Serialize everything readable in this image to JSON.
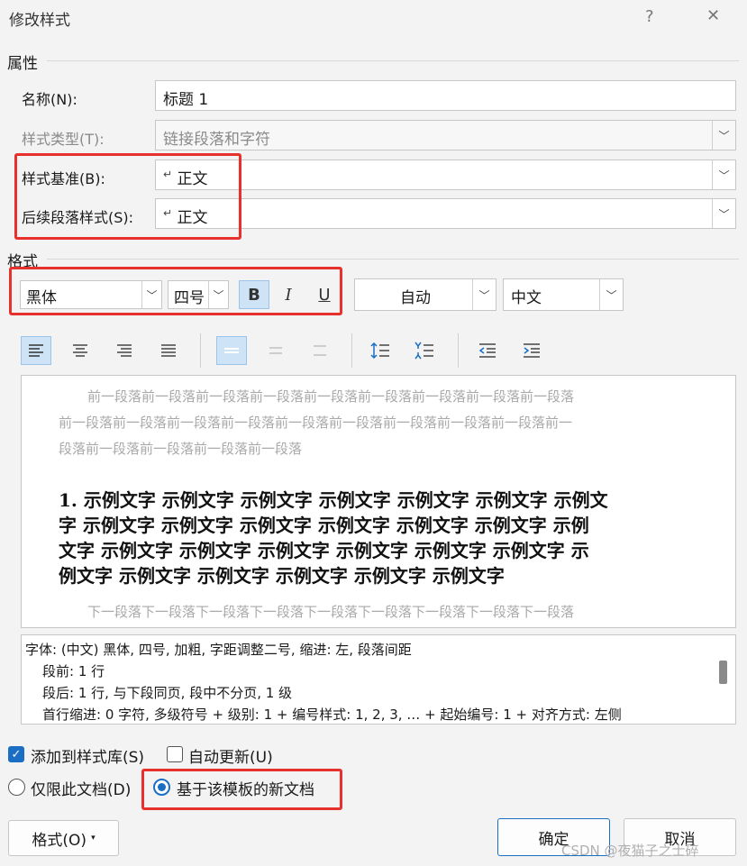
{
  "window": {
    "title": "修改样式",
    "help_glyph": "?",
    "close_glyph": "✕"
  },
  "properties": {
    "section_label": "属性",
    "name_label": "名称(N):",
    "name_value": "标题 1",
    "style_type_label": "样式类型(T):",
    "style_type_value": "链接段落和字符",
    "based_on_label": "样式基准(B):",
    "based_on_value": "正文",
    "next_style_label": "后续段落样式(S):",
    "next_style_value": "正文"
  },
  "format": {
    "section_label": "格式",
    "font": "黑体",
    "size": "四号",
    "bold": "B",
    "italic": "I",
    "underline": "U",
    "color": "自动",
    "script": "中文"
  },
  "preview": {
    "previous_lines": [
      "前一段落前一段落前一段落前一段落前一段落前一段落前一段落前一段落前一段落",
      "前一段落前一段落前一段落前一段落前一段落前一段落前一段落前一段落前一段落前一",
      "段落前一段落前一段落前一段落前一段落"
    ],
    "sample_lines": [
      "1. 示例文字 示例文字 示例文字 示例文字 示例文字 示例文字 示例文",
      "字 示例文字 示例文字 示例文字 示例文字 示例文字 示例文字 示例",
      "文字 示例文字 示例文字 示例文字 示例文字 示例文字 示例文字 示",
      "例文字 示例文字 示例文字 示例文字 示例文字 示例文字"
    ],
    "next_line": "下一段落下一段落下一段落下一段落下一段落下一段落下一段落下一段落下一段落"
  },
  "description": {
    "lines": [
      "字体: (中文) 黑体, 四号, 加粗, 字距调整二号, 缩进: 左, 段落间距",
      "段前: 1 行",
      "段后: 1 行, 与下段同页, 段中不分页, 1 级",
      "首行缩进:  0 字符, 多级符号 + 级别: 1 + 编号样式: 1, 2, 3, … + 起始编号: 1 + 对齐方式: 左侧"
    ]
  },
  "options": {
    "add_to_gallery": "添加到样式库(S)",
    "auto_update": "自动更新(U)",
    "only_this_doc": "仅限此文档(D)",
    "new_docs_template": "基于该模板的新文档"
  },
  "buttons": {
    "format": "格式(O)",
    "ok": "确定",
    "cancel": "取消"
  },
  "watermark": "CSDN @夜猫子之士碎",
  "colors": {
    "highlight_red": "#e8302c",
    "accent_blue": "#1a6fc4"
  }
}
